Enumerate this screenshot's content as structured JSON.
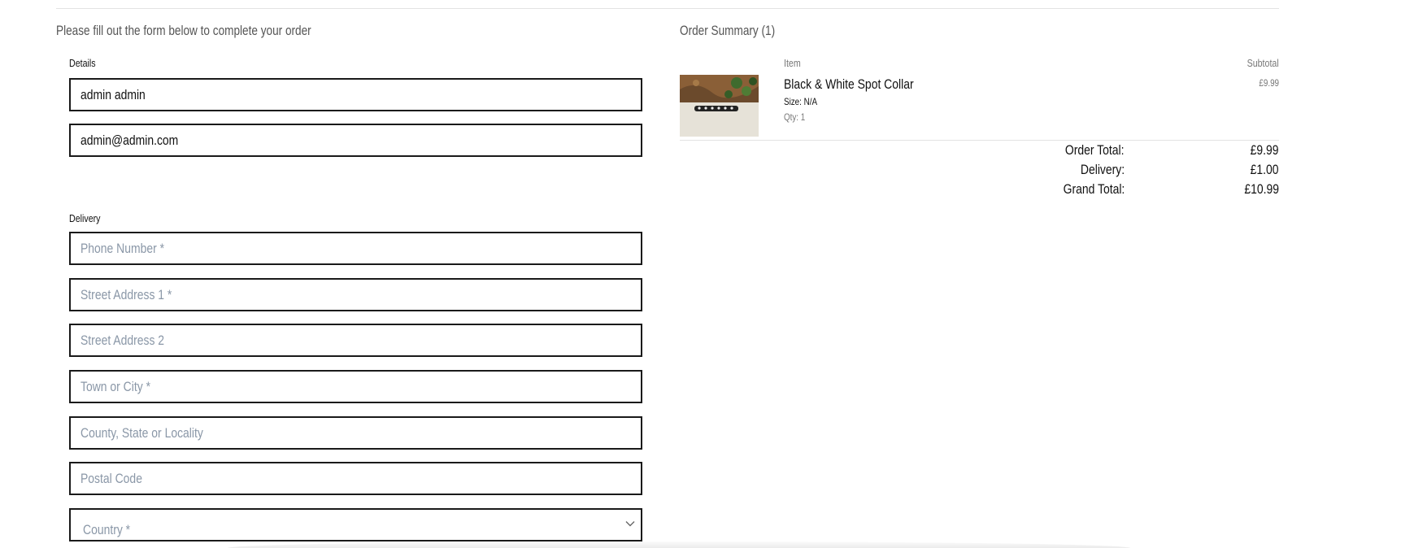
{
  "form": {
    "intro": "Please fill out the form below to complete your order",
    "details_label": "Details",
    "full_name_value": "admin admin",
    "email_value": "admin@admin.com",
    "delivery_label": "Delivery",
    "phone_placeholder": "Phone Number *",
    "street1_placeholder": "Street Address 1 *",
    "street2_placeholder": "Street Address 2",
    "town_placeholder": "Town or City *",
    "county_placeholder": "County, State or Locality",
    "postcode_placeholder": "Postal Code",
    "country_placeholder": "Country *"
  },
  "summary": {
    "title": "Order Summary (1)",
    "item_header": "Item",
    "subtotal_header": "Subtotal",
    "items": [
      {
        "name": "Black & White Spot Collar",
        "size": "Size: N/A",
        "qty": "Qty: 1",
        "subtotal": "£9.99"
      }
    ],
    "order_total_label": "Order Total:",
    "order_total_value": "£9.99",
    "delivery_label": "Delivery:",
    "delivery_value": "£1.00",
    "grand_total_label": "Grand Total:",
    "grand_total_value": "£10.99"
  },
  "icons": {
    "country_dropdown": "chevron-down-icon",
    "product_thumbnail": "product-image"
  }
}
